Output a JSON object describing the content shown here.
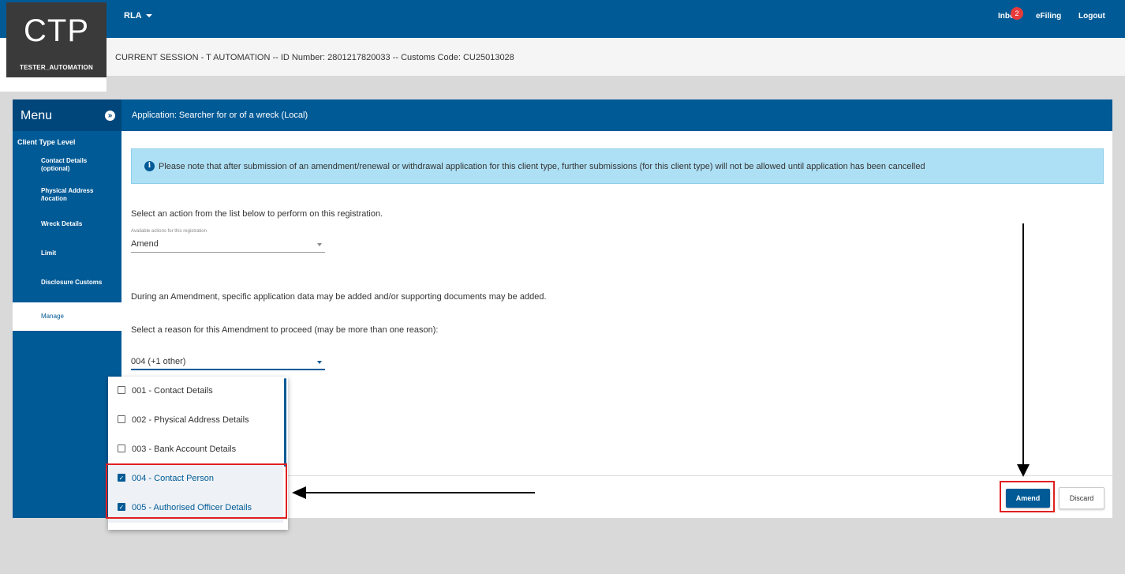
{
  "header": {
    "logo": "CTP",
    "username": "TESTER_AUTOMATION",
    "menu_label": "RLA",
    "inbox_label": "Inbox",
    "inbox_count": "2",
    "efiling_label": "eFiling",
    "logout_label": "Logout",
    "brand_color": "#005a96"
  },
  "session": {
    "text": "CURRENT SESSION - T AUTOMATION -- ID Number: 2801217820033 -- Customs Code: CU25013028"
  },
  "sidebar": {
    "title": "Menu",
    "group": "Client Type Level",
    "items": [
      {
        "label": "Contact Details (optional)"
      },
      {
        "label": "Physical Address /location"
      },
      {
        "label": "Wreck Details"
      },
      {
        "label": "Limit"
      },
      {
        "label": "Disclosure Customs"
      },
      {
        "label": "Manage"
      }
    ]
  },
  "main": {
    "title": "Application: Searcher for or of a wreck (Local)",
    "info": "Please note that after submission of an amendment/renewal or withdrawal application for this client type, further submissions (for this client type) will not be allowed until application has been cancelled",
    "select_action_text": "Select an action from the list below to perform on this registration.",
    "actions_label": "Available actions for this registration",
    "action_value": "Amend",
    "amend_note": "During an Amendment, specific application data may be added and/or supporting documents may be added.",
    "reason_prompt": "Select a reason for this Amendment to proceed (may be more than one reason):",
    "reason_value": "004 (+1 other)",
    "reason_options": [
      {
        "label": "001 - Contact Details",
        "checked": false
      },
      {
        "label": "002 - Physical Address Details",
        "checked": false
      },
      {
        "label": "003 - Bank Account Details",
        "checked": false
      },
      {
        "label": "004 - Contact Person",
        "checked": true
      },
      {
        "label": "005 - Authorised Officer Details",
        "checked": true
      }
    ],
    "amend_button": "Amend",
    "discard_button": "Discard"
  }
}
